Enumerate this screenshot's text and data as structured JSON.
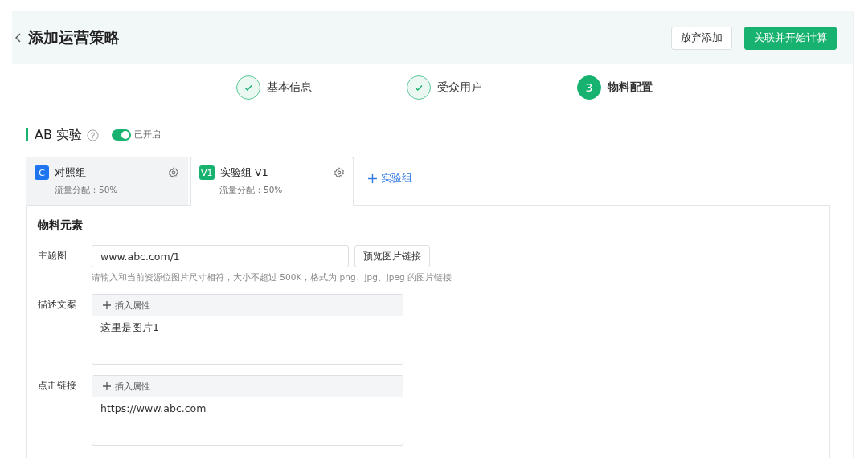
{
  "header": {
    "title": "添加运营策略",
    "buttons": [
      {
        "label": "放弃添加",
        "kind": "secondary"
      },
      {
        "label": "关联并开始计算",
        "kind": "primary"
      }
    ]
  },
  "steps": [
    {
      "label": "基本信息",
      "completed": true,
      "selected": false
    },
    {
      "label": "受众用户",
      "completed": true,
      "selected": false
    },
    {
      "number": "3",
      "label": "物料配置",
      "completed": false,
      "selected": true
    }
  ],
  "ab_test": {
    "title": "AB 实验",
    "toggle": {
      "on": true,
      "label": "已开启"
    }
  },
  "groups": [
    {
      "badge": "C",
      "name": "对照组",
      "traffic": "流量分配：50%",
      "selected": false,
      "color": "#1f74f0"
    },
    {
      "badge": "V1",
      "name": "实验组 V1",
      "traffic": "流量分配：50%",
      "selected": true,
      "color": "#17b26f"
    }
  ],
  "add_group": "实验组",
  "material": {
    "title": "物料元素",
    "fields": [
      {
        "kind": "input",
        "label": "主题图",
        "value": "www.abc.com/1",
        "button": "预览图片链接",
        "hint": "请输入和当前资源位图片尺寸相符，大小不超过 500K，格式为 png、jpg、jpeg 的图片链接"
      },
      {
        "kind": "editor",
        "label": "描述文案",
        "toolbar": "插入属性",
        "value": "这里是图片1"
      },
      {
        "kind": "editor",
        "label": "点击链接",
        "toolbar": "插入属性",
        "value": "https://www.abc.com"
      }
    ]
  }
}
